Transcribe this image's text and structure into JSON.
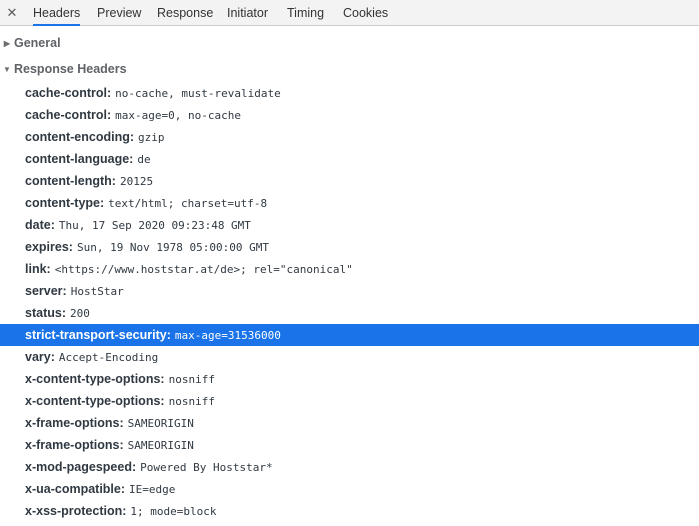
{
  "tabs": {
    "close": "✕",
    "items": [
      "Headers",
      "Preview",
      "Response",
      "Initiator",
      "Timing",
      "Cookies"
    ],
    "active": "Headers"
  },
  "sections": {
    "general": "General",
    "response_headers": "Response Headers"
  },
  "response_headers": [
    {
      "name": "cache-control",
      "value": "no-cache, must-revalidate"
    },
    {
      "name": "cache-control",
      "value": "max-age=0, no-cache"
    },
    {
      "name": "content-encoding",
      "value": "gzip"
    },
    {
      "name": "content-language",
      "value": "de"
    },
    {
      "name": "content-length",
      "value": "20125"
    },
    {
      "name": "content-type",
      "value": "text/html; charset=utf-8"
    },
    {
      "name": "date",
      "value": "Thu, 17 Sep 2020 09:23:48 GMT"
    },
    {
      "name": "expires",
      "value": "Sun, 19 Nov 1978 05:00:00 GMT"
    },
    {
      "name": "link",
      "value": "<https://www.hoststar.at/de>; rel=\"canonical\""
    },
    {
      "name": "server",
      "value": "HostStar"
    },
    {
      "name": "status",
      "value": "200"
    },
    {
      "name": "strict-transport-security",
      "value": "max-age=31536000",
      "selected": true
    },
    {
      "name": "vary",
      "value": "Accept-Encoding"
    },
    {
      "name": "x-content-type-options",
      "value": "nosniff"
    },
    {
      "name": "x-content-type-options",
      "value": "nosniff"
    },
    {
      "name": "x-frame-options",
      "value": "SAMEORIGIN"
    },
    {
      "name": "x-frame-options",
      "value": "SAMEORIGIN"
    },
    {
      "name": "x-mod-pagespeed",
      "value": "Powered By Hoststar*"
    },
    {
      "name": "x-ua-compatible",
      "value": "IE=edge"
    },
    {
      "name": "x-xss-protection",
      "value": "1; mode=block"
    }
  ],
  "colors": {
    "selection": "#1a73e8",
    "tab_underline": "#1a73e8",
    "tabbar_bg": "#f3f3f3"
  }
}
